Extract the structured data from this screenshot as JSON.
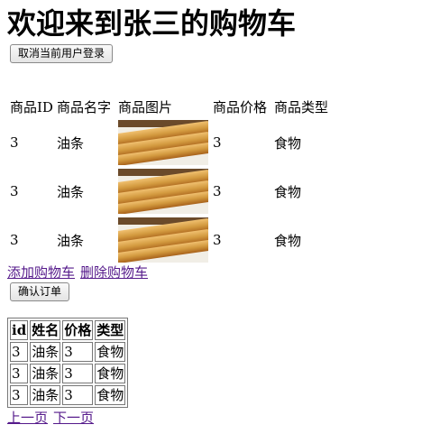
{
  "header": {
    "title": "欢迎来到张三的购物车"
  },
  "buttons": {
    "logout": "取消当前用户登录",
    "confirm": "确认订单"
  },
  "cart": {
    "headers": [
      "商品ID",
      "商品名字",
      "商品图片",
      "商品价格",
      "商品类型"
    ],
    "rows": [
      {
        "id": "3",
        "name": "油条",
        "image": "youtiao-photo",
        "price": "3",
        "type": "食物"
      },
      {
        "id": "3",
        "name": "油条",
        "image": "youtiao-photo",
        "price": "3",
        "type": "食物"
      },
      {
        "id": "3",
        "name": "油条",
        "image": "youtiao-photo",
        "price": "3",
        "type": "食物"
      }
    ]
  },
  "links": {
    "add": "添加购物车",
    "delete": "删除购物车"
  },
  "orders": {
    "headers": [
      "id",
      "姓名",
      "价格",
      "类型"
    ],
    "rows": [
      {
        "id": "3",
        "name": "油条",
        "price": "3",
        "type": "食物"
      },
      {
        "id": "3",
        "name": "油条",
        "price": "3",
        "type": "食物"
      },
      {
        "id": "3",
        "name": "油条",
        "price": "3",
        "type": "食物"
      }
    ]
  },
  "pager": {
    "prev": "上一页",
    "next": "下一页"
  },
  "colors": {
    "link_visited": "#551a8b",
    "food_crust": "#d39a3f",
    "food_dark": "#a8611a",
    "plate": "#f1eee6"
  }
}
